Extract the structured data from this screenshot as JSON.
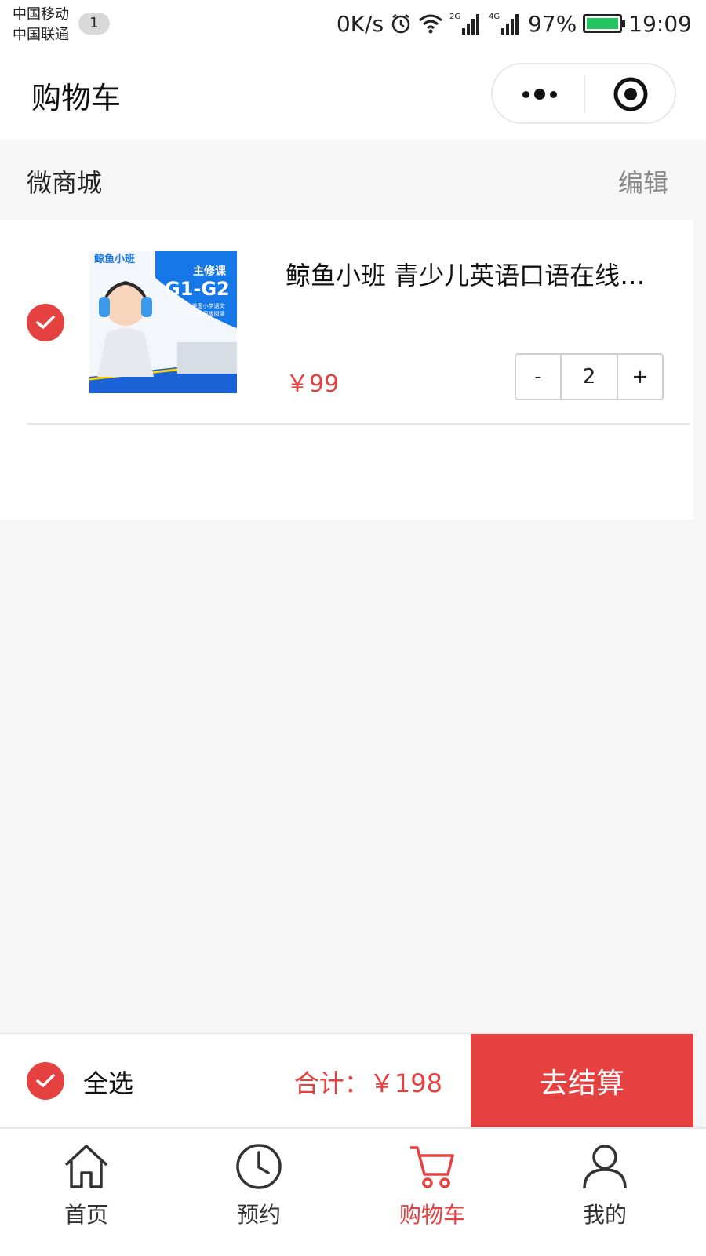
{
  "status_bar": {
    "carrier_1": "中国移动",
    "carrier_2": "中国联通",
    "sim_badge": "1",
    "speed": "0K/s",
    "signal_2g": "2G",
    "signal_4g": "4G",
    "battery_percent": "97%",
    "time": "19:09"
  },
  "nav": {
    "title": "购物车"
  },
  "shop": {
    "name": "微商城",
    "edit_label": "编辑"
  },
  "cart": {
    "items": [
      {
        "title": "鲸鱼小班 青少儿英语口语在线学习课程",
        "price": "￥99",
        "quantity": "2",
        "selected": true,
        "thumb_brand": "鲸鱼小班",
        "thumb_course": "主修课",
        "thumb_grade": "G1-G2",
        "thumb_note_1": "· 美国小学语文",
        "thumb_note_2": "· 经典原版阅读"
      }
    ],
    "minus_label": "-",
    "plus_label": "+"
  },
  "bottom_bar": {
    "select_all_label": "全选",
    "total_label": "合计：￥198",
    "checkout_label": "去结算"
  },
  "tabs": [
    {
      "label": "首页",
      "icon": "home-icon",
      "active": false
    },
    {
      "label": "预约",
      "icon": "clock-icon",
      "active": false
    },
    {
      "label": "购物车",
      "icon": "cart-icon",
      "active": true
    },
    {
      "label": "我的",
      "icon": "user-icon",
      "active": false
    }
  ],
  "colors": {
    "accent": "#e54141",
    "battery": "#22c55e"
  }
}
